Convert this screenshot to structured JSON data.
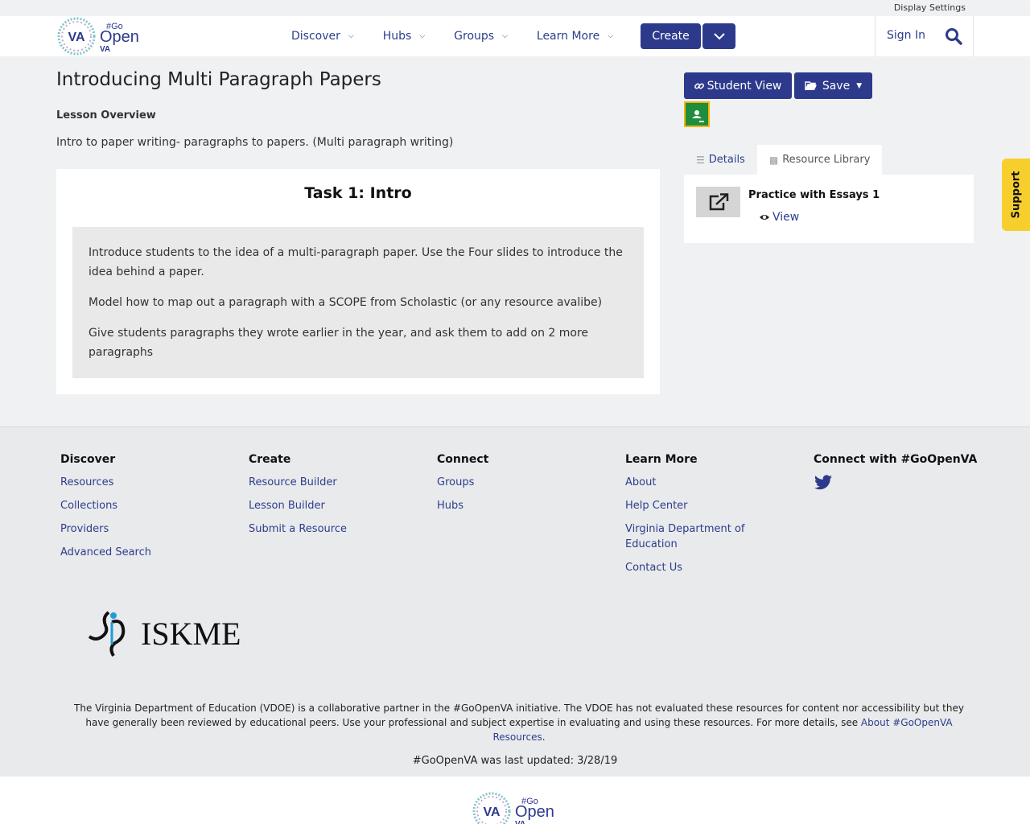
{
  "utility": {
    "display_settings": "Display Settings"
  },
  "header": {
    "logo": {
      "va": "VA",
      "go": "#Go",
      "open": "Open",
      "va_small": "VA"
    },
    "nav": [
      {
        "label": "Discover"
      },
      {
        "label": "Hubs"
      },
      {
        "label": "Groups"
      },
      {
        "label": "Learn More"
      }
    ],
    "create_label": "Create",
    "sign_in": "Sign In",
    "icons": {
      "search": "search-icon",
      "chevron": "chevron-down-icon"
    }
  },
  "main": {
    "title": "Introducing Multi Paragraph Papers",
    "overview_label": "Lesson Overview",
    "overview_text": "Intro to paper writing- paragraphs to papers. (Multi paragraph writing)",
    "task": {
      "title": "Task 1: Intro",
      "paragraphs": [
        "Introduce students to the idea of a multi-paragraph paper. Use the Four slides to introduce the idea behind a paper.",
        "Model how to map out a paragraph with a SCOPE from Scholastic (or any resource avalibe)",
        "Give students paragraphs they wrote earlier in the year, and ask them to add on 2 more paragraphs"
      ]
    }
  },
  "sidebar": {
    "student_view": "Student View",
    "save": "Save",
    "tabs": [
      {
        "label": "Details",
        "icon": "list-icon"
      },
      {
        "label": "Resource Library",
        "icon": "book-icon"
      }
    ],
    "resource": {
      "title": "Practice with Essays 1",
      "view": "View",
      "icon": "external-link-icon"
    }
  },
  "support": "Support",
  "footer": {
    "columns": [
      {
        "heading": "Discover",
        "links": [
          "Resources",
          "Collections",
          "Providers",
          "Advanced Search"
        ]
      },
      {
        "heading": "Create",
        "links": [
          "Resource Builder",
          "Lesson Builder",
          "Submit a Resource"
        ]
      },
      {
        "heading": "Connect",
        "links": [
          "Groups",
          "Hubs"
        ]
      },
      {
        "heading": "Learn More",
        "links": [
          "About",
          "Help Center",
          "Virginia Department of Education",
          "Contact Us"
        ]
      }
    ],
    "connect_heading": "Connect with #GoOpenVA",
    "iskme": "ISKME",
    "disclaimer_text": "The Virginia Department of Education (VDOE) is a collaborative partner in the #GoOpenVA initiative. The VDOE has not evaluated these resources for content nor accessibility but they have generally been reviewed by educational peers. Use your professional and subject expertise in evaluating and using these resources. For more details, see ",
    "disclaimer_link": "About #GoOpenVA Resources",
    "disclaimer_end": ".",
    "updated": "#GoOpenVA was last updated: 3/28/19"
  },
  "colors": {
    "primary": "#2d3a8c",
    "support": "#f7cf2d",
    "classroom": "#1e8e3e"
  }
}
